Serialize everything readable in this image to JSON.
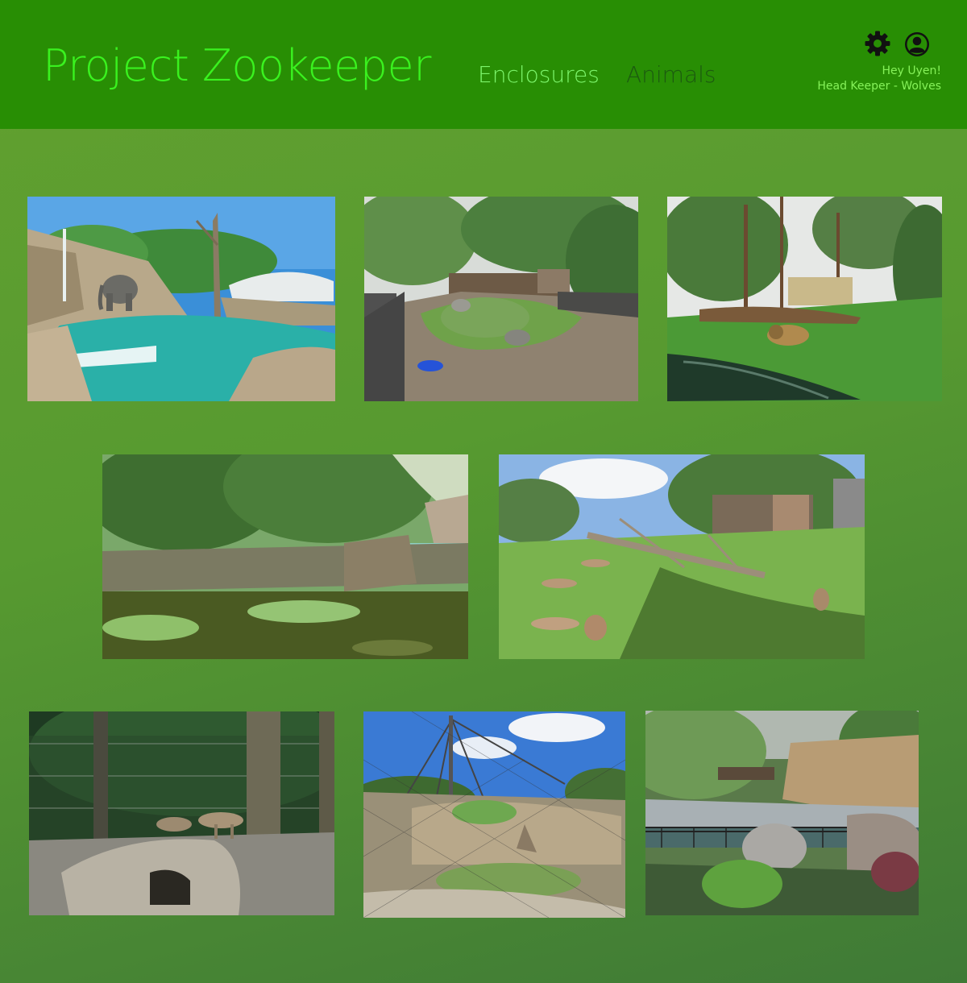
{
  "header": {
    "title": "Project Zookeeper",
    "nav": [
      {
        "label": "Enclosures",
        "active": true
      },
      {
        "label": "Animals",
        "active": false
      }
    ],
    "icons": [
      "gear-icon",
      "user-account-icon"
    ],
    "greeting": "Hey Uyen!",
    "role": "Head Keeper - Wolves"
  },
  "colors": {
    "header_bg": "#288e04",
    "title": "#3af21f",
    "nav_active": "#7cf46b",
    "nav_inactive": "#1c5a10",
    "page_bg": "#5a9c30"
  },
  "enclosures": [
    {
      "name": "elephant-enclosure-photo"
    },
    {
      "name": "muddy-hill-enclosure-photo"
    },
    {
      "name": "lion-enclosure-photo"
    },
    {
      "name": "tropical-pond-enclosure-photo"
    },
    {
      "name": "kangaroo-enclosure-photo"
    },
    {
      "name": "wolf-enclosure-photo"
    },
    {
      "name": "netted-aviary-enclosure-photo"
    },
    {
      "name": "tropical-hall-enclosure-photo"
    }
  ]
}
